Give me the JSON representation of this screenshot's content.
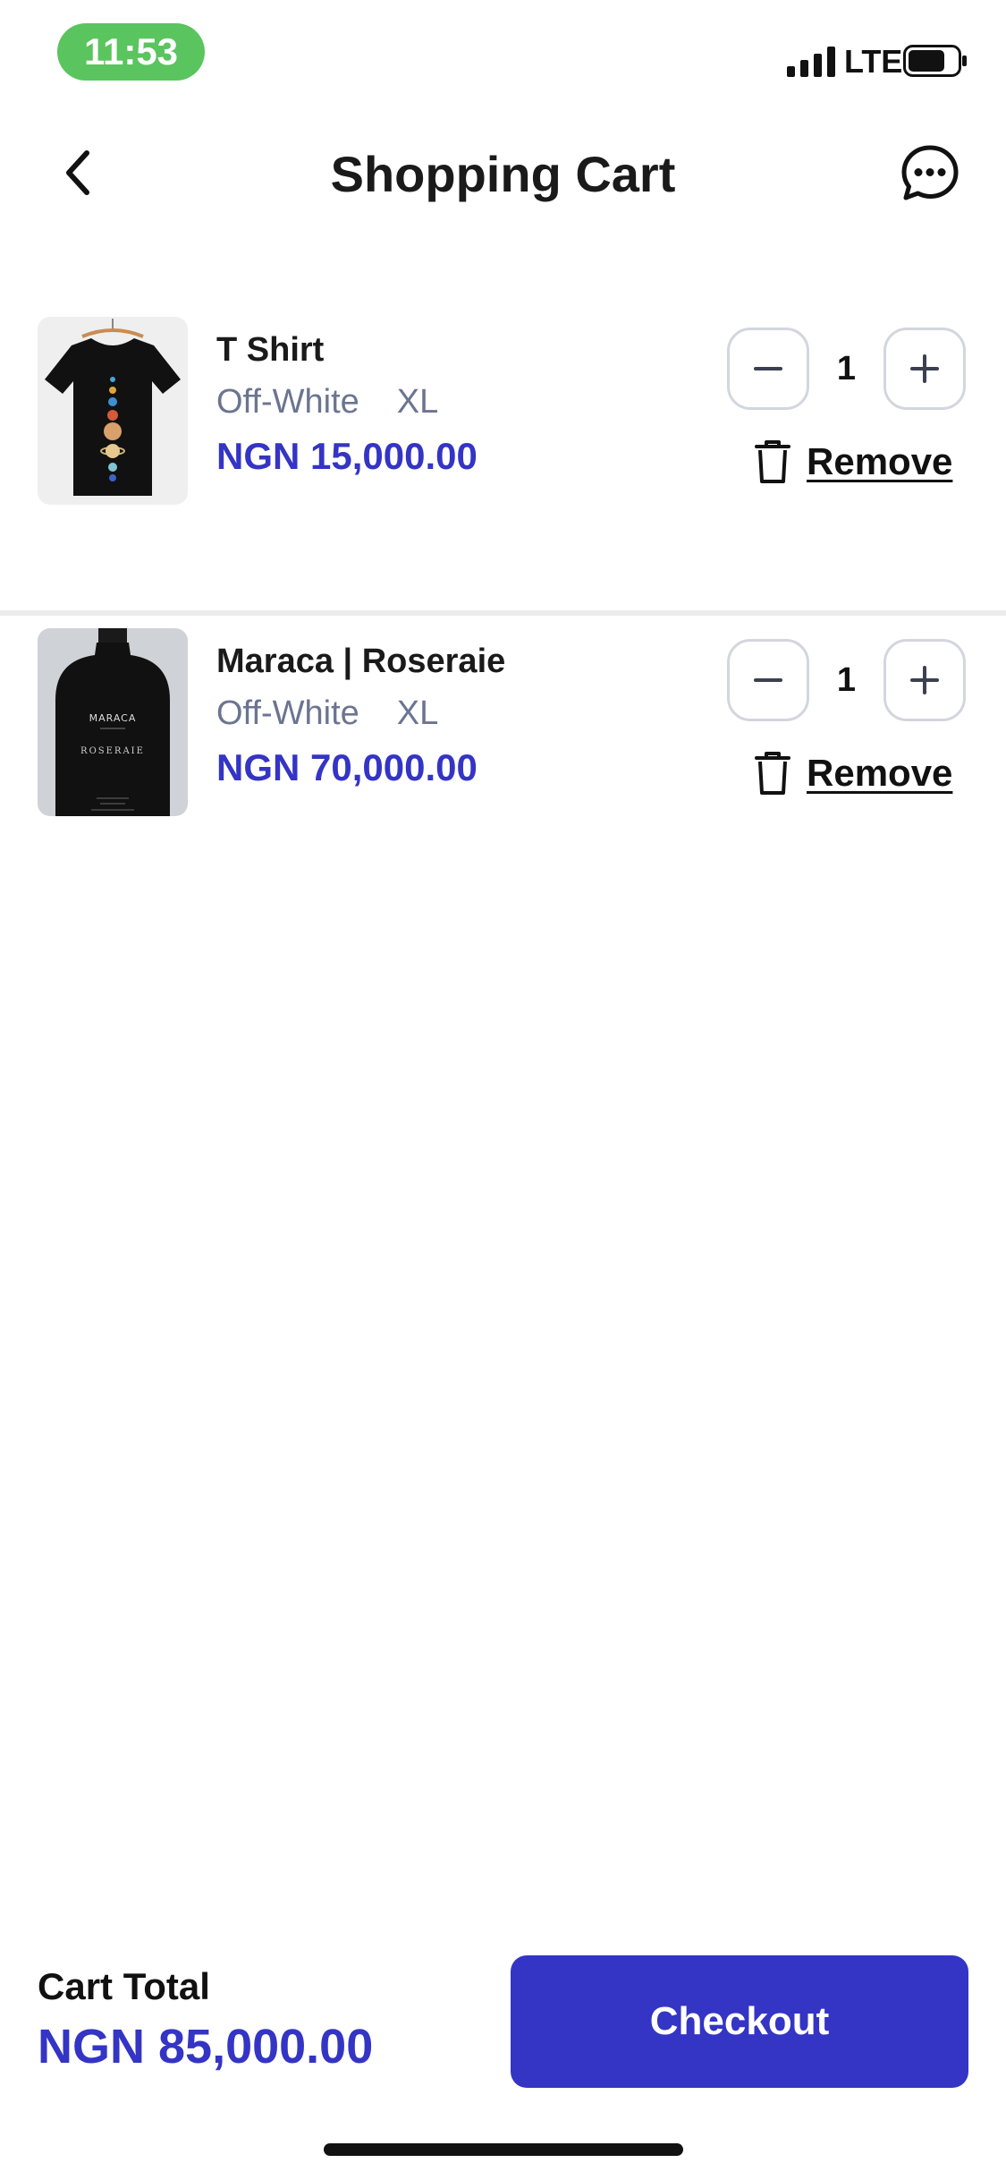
{
  "status_bar": {
    "time": "11:53",
    "network": "LTE",
    "icons": [
      "signal-icon",
      "battery-icon"
    ]
  },
  "header": {
    "title": "Shopping Cart",
    "back_icon": "chevron-left-icon",
    "chat_icon": "chat-bubble-icon"
  },
  "cart": {
    "items": [
      {
        "name": "T Shirt",
        "color": "Off-White",
        "size": "XL",
        "price": "NGN 15,000.00",
        "quantity": "1",
        "remove_label": "Remove",
        "image": "tshirt-image"
      },
      {
        "name": "Maraca | Roseraie",
        "color": "Off-White",
        "size": "XL",
        "price": "NGN 70,000.00",
        "quantity": "1",
        "remove_label": "Remove",
        "image": "perfume-bottle-image",
        "bottle_brand": "MARACA",
        "bottle_product": "ROSERAIE"
      }
    ]
  },
  "footer": {
    "total_label": "Cart Total",
    "total_value": "NGN 85,000.00",
    "checkout_label": "Checkout"
  },
  "colors": {
    "accent": "#3434c5",
    "status_pill": "#5ac45e",
    "muted_text": "#6b7591",
    "stepper_border": "#d3d6de",
    "divider": "#ececef"
  }
}
